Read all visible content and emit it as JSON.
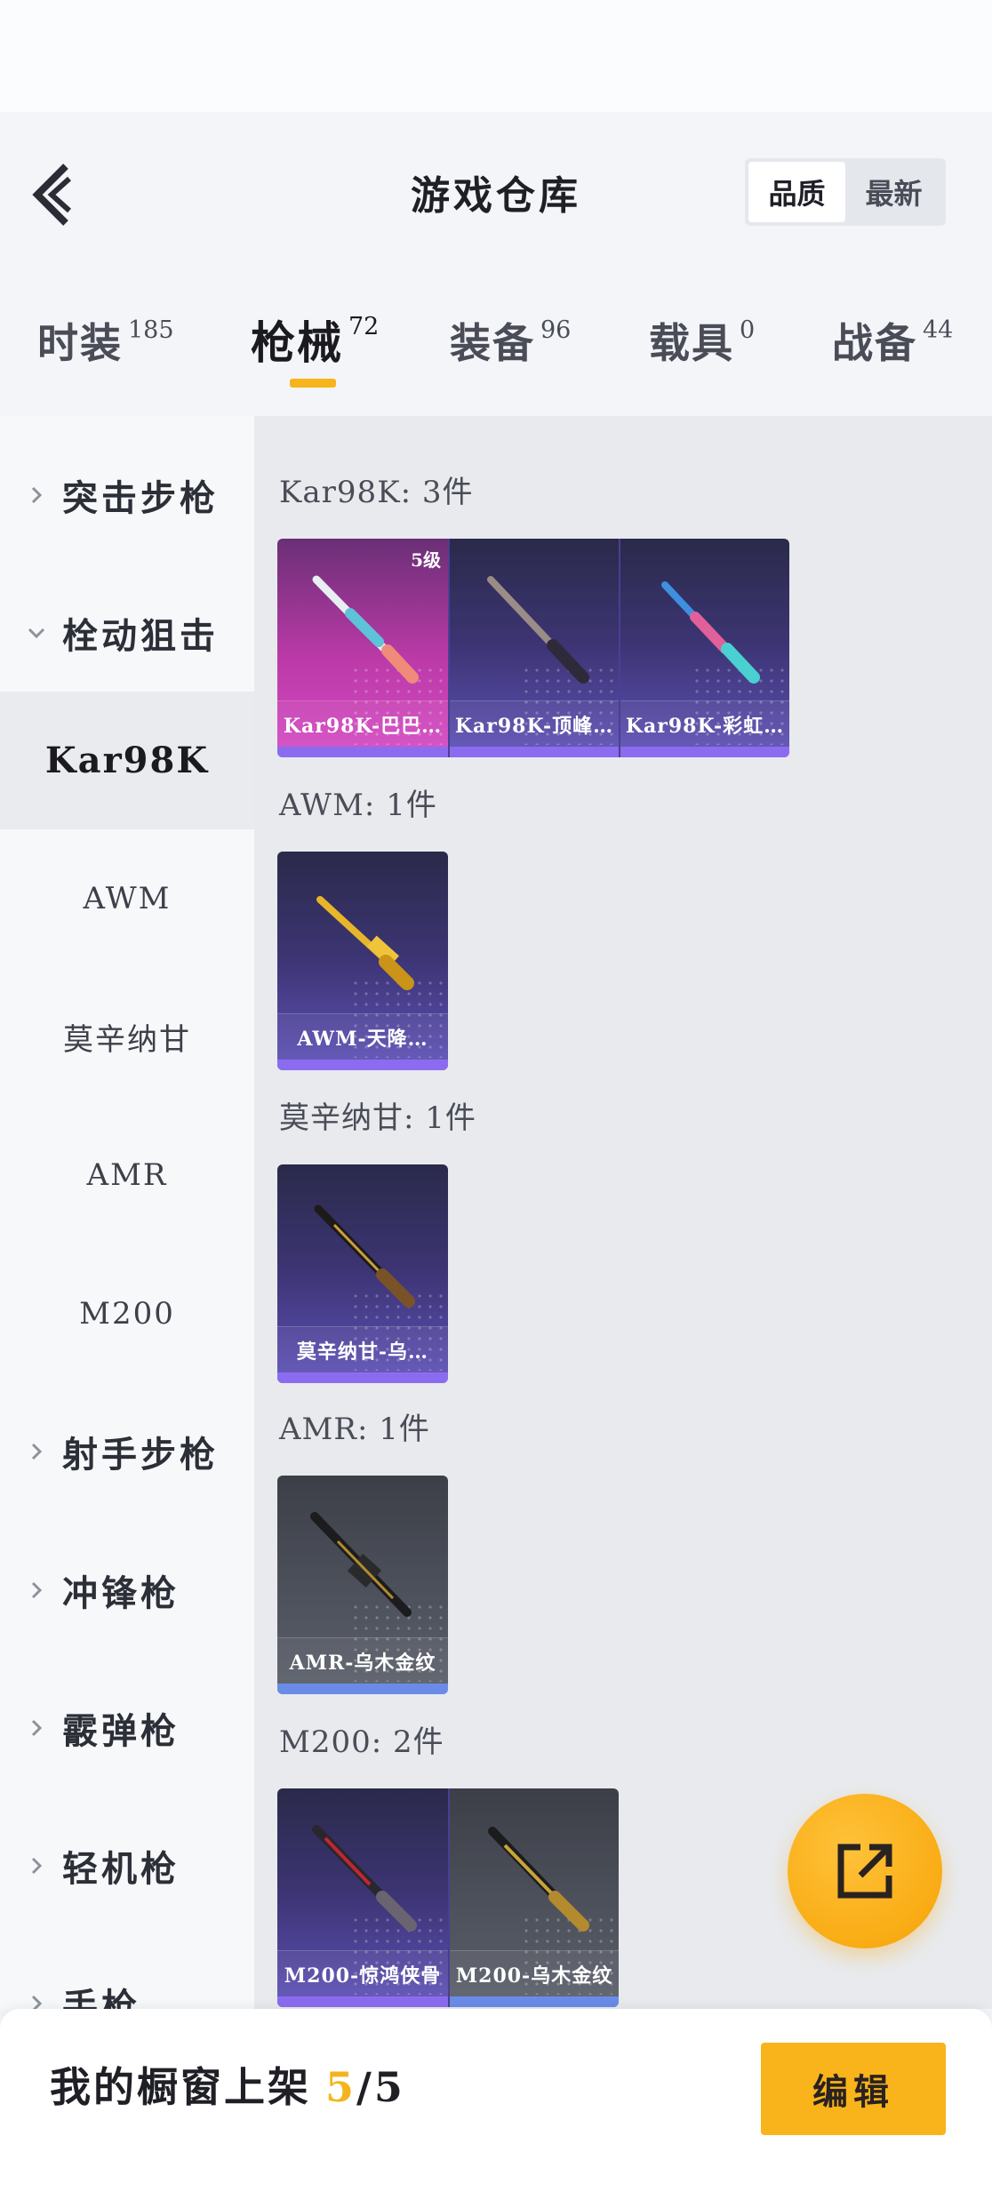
{
  "header": {
    "title": "游戏仓库",
    "sort_options": [
      "品质",
      "最新"
    ],
    "active_sort": "品质"
  },
  "tabs": [
    {
      "label": "时装",
      "count": "185"
    },
    {
      "label": "枪械",
      "count": "72"
    },
    {
      "label": "装备",
      "count": "96"
    },
    {
      "label": "载具",
      "count": "0"
    },
    {
      "label": "战备",
      "count": "44"
    }
  ],
  "active_tab": "枪械",
  "sidebar": {
    "categories": {
      "assault": "突击步枪",
      "sniper": "栓动狙击",
      "marksman": "射手步枪",
      "smg": "冲锋枪",
      "shotgun": "霰弹枪",
      "lmg": "轻机枪",
      "pistol": "手枪"
    },
    "sniper_sub": [
      "Kar98K",
      "AWM",
      "莫辛纳甘",
      "AMR",
      "M200"
    ],
    "active_sub": "Kar98K"
  },
  "groups": [
    {
      "title": "Kar98K: 3件",
      "items": [
        {
          "name": "Kar98K-巴巴…",
          "grade": "5级",
          "rarity": "pink"
        },
        {
          "name": "Kar98K-顶峰…",
          "rarity": "purple"
        },
        {
          "name": "Kar98K-彩虹…",
          "rarity": "purple"
        }
      ]
    },
    {
      "title": "AWM: 1件",
      "items": [
        {
          "name": "AWM-天降…",
          "rarity": "purple"
        }
      ]
    },
    {
      "title": "莫辛纳甘: 1件",
      "items": [
        {
          "name": "莫辛纳甘-乌…",
          "rarity": "purple"
        }
      ]
    },
    {
      "title": "AMR: 1件",
      "items": [
        {
          "name": "AMR-乌木金纹",
          "rarity": "gray"
        }
      ]
    },
    {
      "title": "M200: 2件",
      "items": [
        {
          "name": "M200-惊鸿侠骨",
          "rarity": "purple"
        },
        {
          "name": "M200-乌木金纹",
          "rarity": "gray"
        }
      ]
    }
  ],
  "bottom": {
    "shelf_label": "我的橱窗上架",
    "shelf_current": "5",
    "shelf_sep": "/",
    "shelf_total": "5",
    "edit_label": "编辑"
  },
  "colors": {
    "accent": "#f8b41a",
    "pink_card": "#c13fb0",
    "purple_card": "#4b3f8f",
    "gray_card": "#4f535d"
  },
  "icons": {
    "back": "back-chevron-icon",
    "fab": "share-external-icon",
    "expand": "chevron-right-icon",
    "collapse": "chevron-down-icon"
  }
}
